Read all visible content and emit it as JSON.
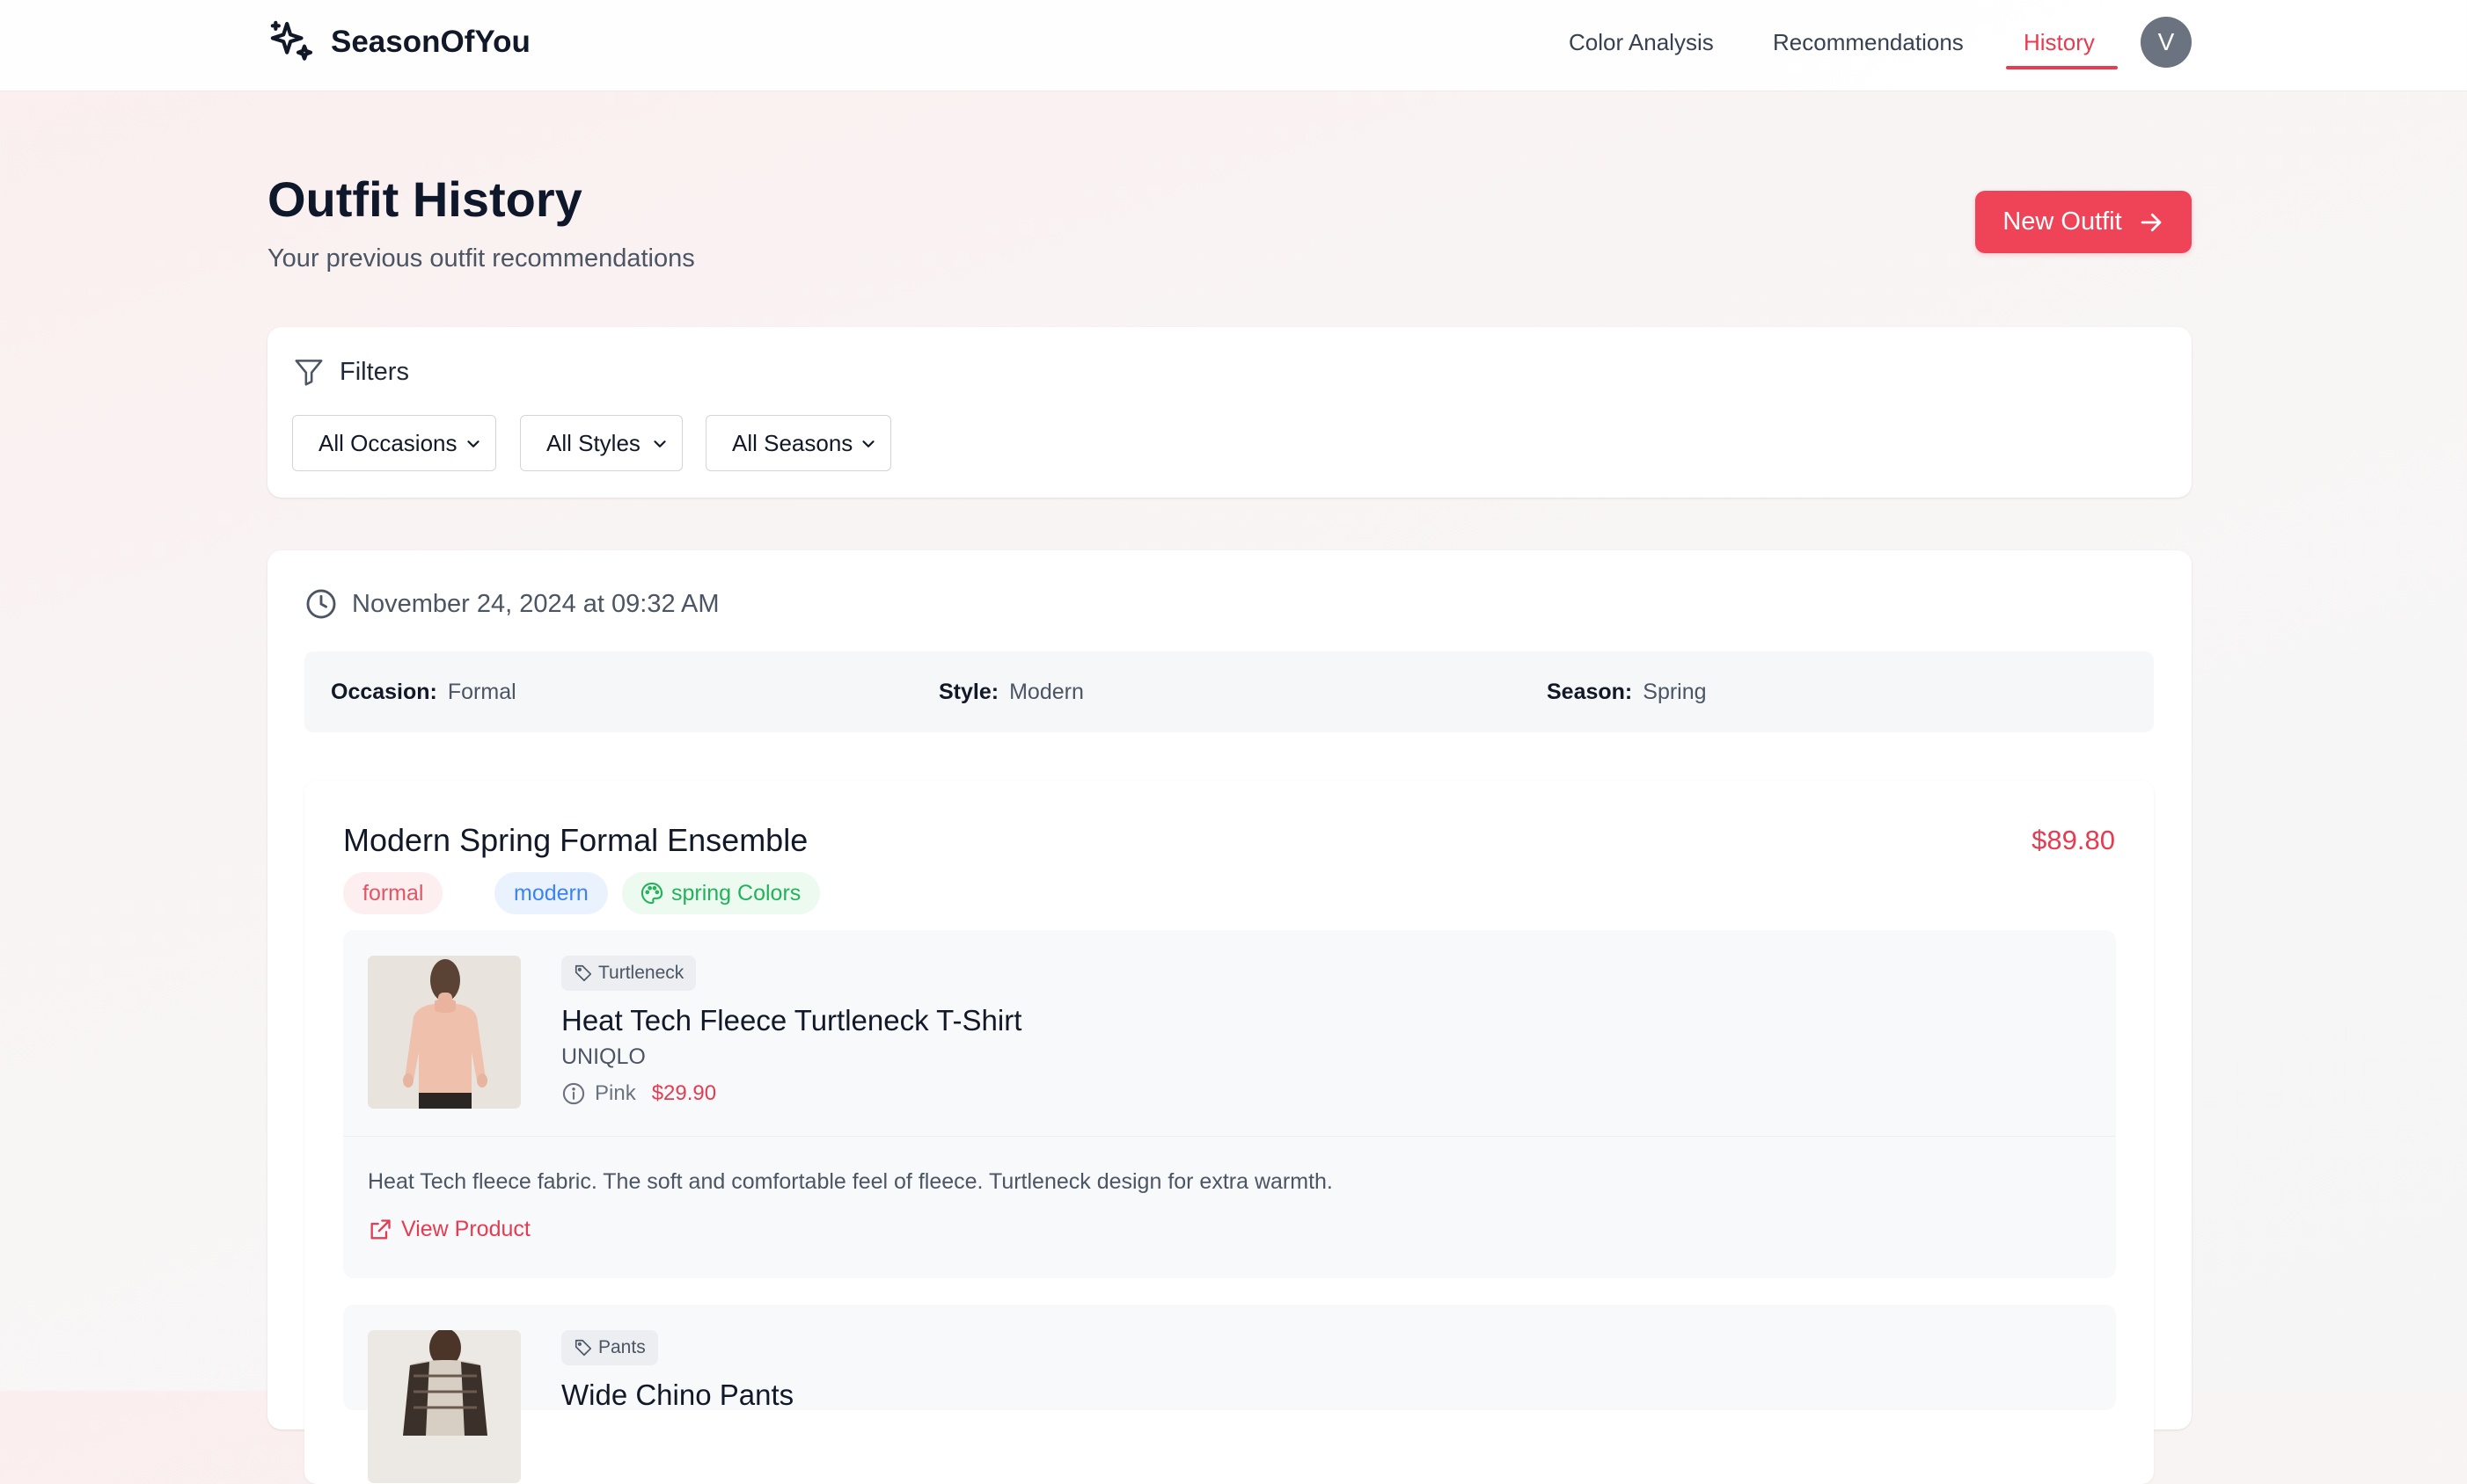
{
  "app": {
    "logo_text": "SeasonOfYou"
  },
  "nav": {
    "links": [
      {
        "label": "Color Analysis"
      },
      {
        "label": "Recommendations"
      },
      {
        "label": "History",
        "active": true
      }
    ],
    "avatar_initial": "V"
  },
  "header": {
    "title": "Outfit History",
    "subtitle": "Your previous outfit recommendations",
    "new_outfit_label": "New Outfit"
  },
  "filters": {
    "title": "Filters",
    "selects": [
      {
        "value": "All Occasions"
      },
      {
        "value": "All Styles"
      },
      {
        "value": "All Seasons"
      }
    ]
  },
  "history": [
    {
      "date": "November 24, 2024 at 09:32 AM",
      "meta": {
        "occasion_label": "Occasion:",
        "occasion": "Formal",
        "style_label": "Style:",
        "style": "Modern",
        "season_label": "Season:",
        "season": "Spring"
      },
      "outfit": {
        "title": "Modern Spring Formal Ensemble",
        "price": "$89.80",
        "tags": [
          "formal",
          "modern",
          "spring Colors"
        ],
        "items": [
          {
            "category": "Turtleneck",
            "name": "Heat Tech Fleece Turtleneck T-Shirt",
            "brand": "UNIQLO",
            "color": "Pink",
            "price": "$29.90",
            "description": "Heat Tech fleece fabric. The soft and comfortable feel of fleece. Turtleneck design for extra warmth.",
            "link_label": "View Product"
          },
          {
            "category": "Pants",
            "name": "Wide Chino Pants"
          }
        ]
      }
    }
  ],
  "colors": {
    "accent": "#ef4458",
    "accent_text": "#e63b50",
    "modern_tag": "#3b82f6",
    "spring_tag": "#22b35a"
  }
}
